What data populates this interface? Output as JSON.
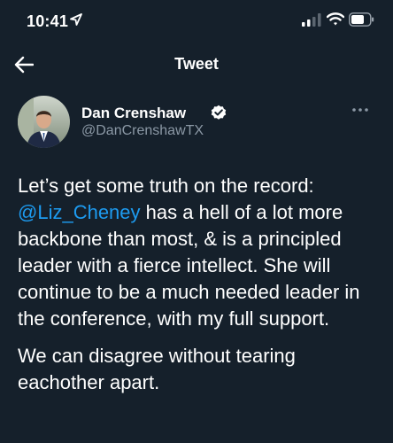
{
  "status_bar": {
    "time": "10:41",
    "icons": [
      "location-arrow-icon",
      "cellular-signal-icon",
      "wifi-icon",
      "battery-icon"
    ]
  },
  "nav": {
    "back_icon": "arrow-left-icon",
    "title": "Tweet"
  },
  "author": {
    "name": "Dan Crenshaw",
    "handle": "@DanCrenshawTX",
    "verified_icon": "verified-badge-icon",
    "more_icon": "more-horizontal-icon"
  },
  "tweet": {
    "p1_before": "Let’s get some truth on the record: ",
    "mention": "@Liz_Cheney",
    "p1_after": " has a hell of a lot more backbone than most, & is a principled leader with a fierce intellect. She will continue to be a much needed leader in the conference, with my full support.",
    "p2": "We can disagree without tearing eachother apart."
  },
  "colors": {
    "background": "#15202b",
    "text": "#ffffff",
    "secondary_text": "#8b98a5",
    "accent": "#1d9bf0"
  }
}
